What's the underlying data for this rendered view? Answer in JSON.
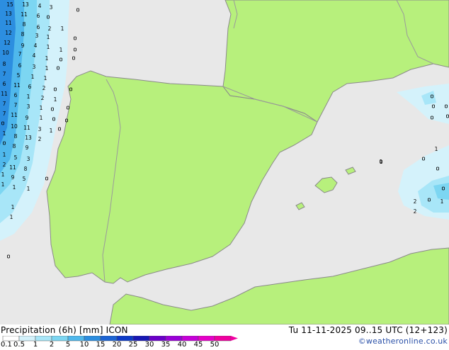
{
  "header": {
    "product": "Precipitation (6h) [mm] ICON",
    "valid_time": "Tu 11-11-2025 09..15 UTC (12+123)",
    "credit": "©weatheronline.co.uk"
  },
  "colors": {
    "land": "#b7f07c",
    "sea": "#e8e8e8",
    "coast": "#8a8a8a",
    "border": "#9a9a9a"
  },
  "legend": {
    "labels": [
      "0.1",
      "0.5",
      "1",
      "2",
      "5",
      "10",
      "15",
      "20",
      "25",
      "30",
      "35",
      "40",
      "45",
      "50"
    ],
    "colors": [
      "#ffffff",
      "#d4f2fb",
      "#a8e6f8",
      "#7cd6f2",
      "#4fb8ec",
      "#2c8ee0",
      "#1c64d4",
      "#0c3ac8",
      "#1818b4",
      "#6a00c8",
      "#9a00d8",
      "#c600d8",
      "#e600c8",
      "#f000a0"
    ]
  },
  "precip_labels": [
    "15",
    "13",
    "4",
    "3",
    "0",
    "13",
    "11",
    "6",
    "0",
    "11",
    "8",
    "6",
    "2",
    "1",
    "12",
    "8",
    "3",
    "1",
    "0",
    "12",
    "9",
    "4",
    "1",
    "1",
    "0",
    "10",
    "7",
    "4",
    "1",
    "0",
    "0",
    "8",
    "6",
    "3",
    "1",
    "0",
    "7",
    "5",
    "1",
    "1",
    "6",
    "11",
    "6",
    "2",
    "0",
    "0",
    "11",
    "6",
    "1",
    "2",
    "1",
    "7",
    "7",
    "3",
    "1",
    "0",
    "0",
    "7",
    "11",
    "9",
    "1",
    "0",
    "0",
    "10",
    "11",
    "3",
    "1",
    "1",
    "8",
    "13",
    "2",
    "0",
    "8",
    "9",
    "1",
    "5",
    "3",
    "2",
    "11",
    "8",
    "1",
    "9",
    "5",
    "1",
    "1",
    "1",
    "1",
    "1",
    "0",
    "0",
    "0",
    "0",
    "0",
    "1",
    "1",
    "0",
    "0",
    "0",
    "2",
    "0",
    "1",
    "2",
    "0"
  ]
}
